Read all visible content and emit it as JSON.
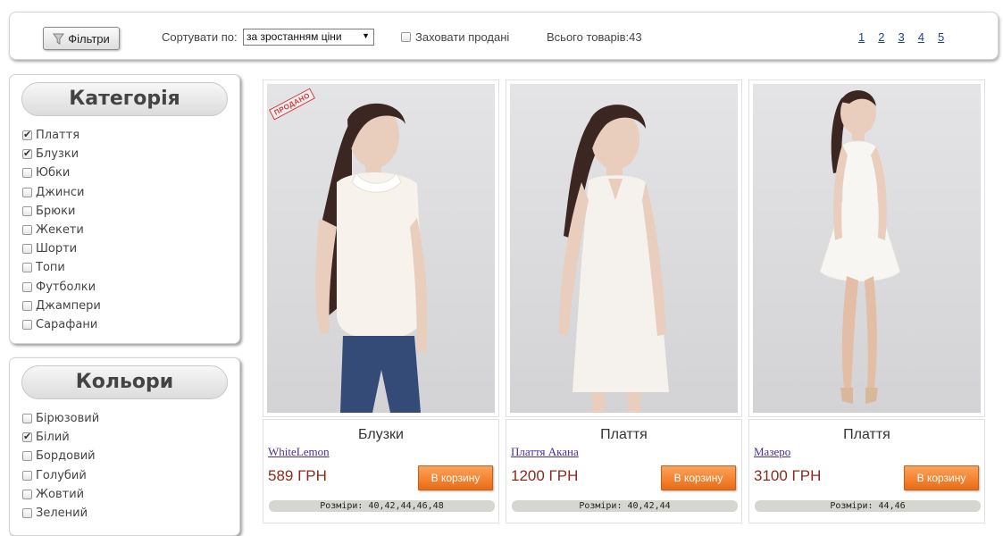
{
  "toolbar": {
    "filter_label": "Фільтри",
    "sort_label": "Сортувати по:",
    "sort_value": "за зростанням ціни",
    "hide_sold_label": "Заховати продані",
    "hide_sold_checked": false,
    "total_label": "Всього товарів:43",
    "pages": [
      "1",
      "2",
      "3",
      "4",
      "5"
    ]
  },
  "category_panel": {
    "title": "Категорія",
    "items": [
      {
        "label": "Плаття",
        "checked": true
      },
      {
        "label": "Блузки",
        "checked": true
      },
      {
        "label": "Юбки",
        "checked": false
      },
      {
        "label": "Джинси",
        "checked": false
      },
      {
        "label": "Брюки",
        "checked": false
      },
      {
        "label": "Жекети",
        "checked": false
      },
      {
        "label": "Шорти",
        "checked": false
      },
      {
        "label": "Топи",
        "checked": false
      },
      {
        "label": "Футболки",
        "checked": false
      },
      {
        "label": "Джампери",
        "checked": false
      },
      {
        "label": "Сарафани",
        "checked": false
      }
    ]
  },
  "color_panel": {
    "title": "Кольори",
    "items": [
      {
        "label": "Бірюзовий",
        "checked": false
      },
      {
        "label": "Білий",
        "checked": true
      },
      {
        "label": "Бордовий",
        "checked": false
      },
      {
        "label": "Голубий",
        "checked": false
      },
      {
        "label": "Жовтий",
        "checked": false
      },
      {
        "label": "Зелений",
        "checked": false
      }
    ]
  },
  "products": [
    {
      "category": "Блузки",
      "name": "WhiteLemon",
      "price": "589 ГРН",
      "cart_label": "В корзину",
      "sizes": "Розміри: 40,42,44,46,48",
      "sold_stamp": "ПРОДАНО"
    },
    {
      "category": "Плаття",
      "name": "Плаття Акана",
      "price": "1200 ГРН",
      "cart_label": "В корзину",
      "sizes": "Розміри: 40,42,44"
    },
    {
      "category": "Плаття",
      "name": "Мазеро",
      "price": "3100 ГРН",
      "cart_label": "В корзину",
      "sizes": "Розміри: 44,46"
    }
  ],
  "colors": {
    "accent_orange": "#ec6b12",
    "price_red": "#8b2a1a",
    "link_purple": "#4a2ca0",
    "page_link": "#1a3f9e"
  }
}
